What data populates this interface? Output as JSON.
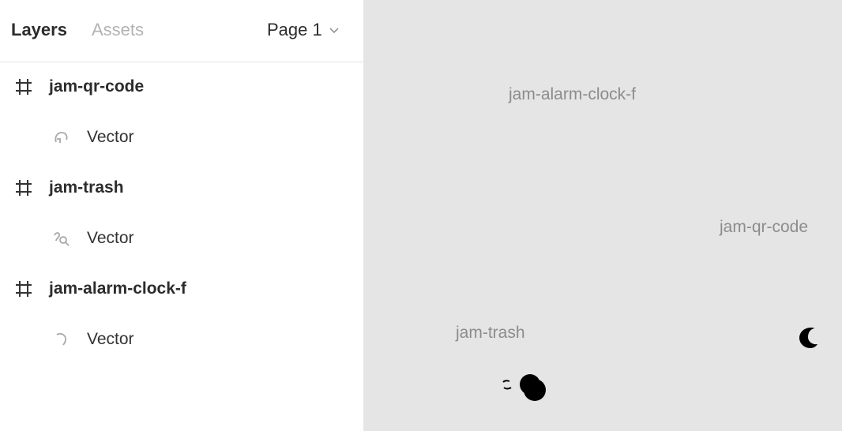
{
  "panel": {
    "tabs": [
      {
        "label": "Layers",
        "active": true
      },
      {
        "label": "Assets",
        "active": false
      }
    ],
    "page_selector": {
      "label": "Page 1",
      "icon": "chevron-down-icon"
    }
  },
  "layers": [
    {
      "frame": "jam-qr-code",
      "frame_icon": "frame-icon",
      "child": "Vector",
      "child_icon": "vector-icon"
    },
    {
      "frame": "jam-trash",
      "frame_icon": "frame-icon",
      "child": "Vector",
      "child_icon": "vector-icon"
    },
    {
      "frame": "jam-alarm-clock-f",
      "frame_icon": "frame-icon",
      "child": "Vector",
      "child_icon": "vector-icon"
    }
  ],
  "canvas": {
    "background": "#e5e5e5",
    "frame_labels": [
      "jam-alarm-clock-f",
      "jam-qr-code",
      "jam-trash"
    ]
  },
  "colors": {
    "active_tab": "#2c2c2c",
    "inactive_tab": "#b3b3b3",
    "canvas_label": "#8c8c8c",
    "shape_fill": "#000000"
  }
}
